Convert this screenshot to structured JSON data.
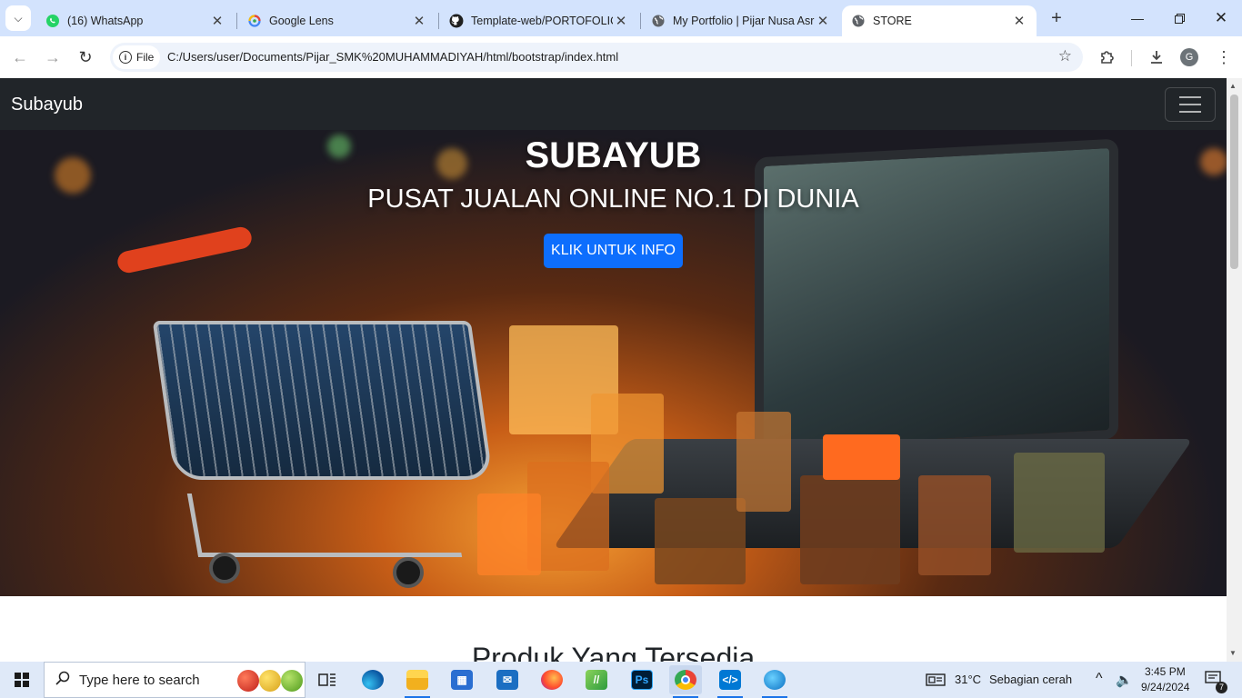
{
  "browser": {
    "tabs": [
      {
        "title": "(16) WhatsApp",
        "icon": "whatsapp-icon"
      },
      {
        "title": "Google Lens",
        "icon": "google-lens-icon"
      },
      {
        "title": "Template-web/PORTOFOLIO",
        "icon": "github-icon"
      },
      {
        "title": "My Portfolio | Pijar Nusa Asri",
        "icon": "globe-icon"
      },
      {
        "title": "STORE",
        "icon": "globe-icon",
        "active": true
      }
    ],
    "address": {
      "scheme_label": "File",
      "url": "C:/Users/user/Documents/Pijar_SMK%20MUHAMMADIYAH/html/bootstrap/index.html"
    },
    "profile_initial": "G"
  },
  "page": {
    "brand": "Subayub",
    "hero": {
      "title": "SUBAYUB",
      "subtitle": "PUSAT JUALAN ONLINE NO.1 DI DUNIA",
      "button": "KLIK UNTUK INFO"
    },
    "section_title": "Produk Yang Tersedia"
  },
  "taskbar": {
    "search_placeholder": "Type here to search",
    "weather": {
      "temp": "31°C",
      "desc": "Sebagian cerah"
    },
    "time": "3:45 PM",
    "date": "9/24/2024",
    "notification_count": "7"
  },
  "colors": {
    "navbar": "#212529",
    "primary_button": "#0d6efd",
    "tab_strip": "#d3e3fd"
  }
}
